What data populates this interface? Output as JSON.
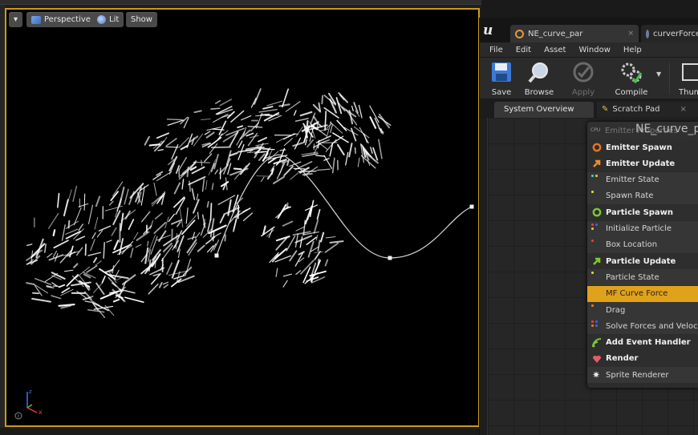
{
  "viewport": {
    "options_label": "▾",
    "perspective_label": "Perspective",
    "lit_label": "Lit",
    "show_label": "Show",
    "gizmo_icon": "axis-gizmo-icon"
  },
  "editor": {
    "tabs": [
      {
        "label": "NE_curve_par",
        "close": "×",
        "color": "#e09b40"
      },
      {
        "label": "curverForce",
        "color": "#9fb0c8"
      }
    ],
    "menu": [
      "File",
      "Edit",
      "Asset",
      "Window",
      "Help"
    ],
    "toolbar": {
      "save": "Save",
      "browse": "Browse",
      "apply": "Apply",
      "compile": "Compile",
      "thumbnail": "Thum"
    },
    "panel_tabs": {
      "system_overview": "System Overview",
      "scratch_pad": "Scratch Pad",
      "scratch_close": "×"
    },
    "stack": {
      "cpu_badge": "CPU",
      "header_faded": "Emitter Properties",
      "title": "NE_curve_p",
      "rows": [
        {
          "label": "Emitter Spawn",
          "kind": "group",
          "icon": "emitter-spawn-icon",
          "color": "#e8741e"
        },
        {
          "label": "Emitter Update",
          "kind": "group",
          "icon": "emitter-update-icon",
          "color": "#f08a28"
        },
        {
          "label": "Emitter State",
          "kind": "module",
          "dots": [
            "#40c8c8",
            "#e0c040"
          ]
        },
        {
          "label": "Spawn Rate",
          "kind": "module",
          "dots": [
            "#e0d040"
          ]
        },
        {
          "label": "Particle Spawn",
          "kind": "group",
          "icon": "particle-spawn-icon",
          "color": "#7cc832"
        },
        {
          "label": "Initialize Particle",
          "kind": "module",
          "dots": [
            "#e04040",
            "#4060e0",
            "#e0c040"
          ]
        },
        {
          "label": "Box Location",
          "kind": "module",
          "dots": [
            "#e04040"
          ]
        },
        {
          "label": "Particle Update",
          "kind": "group",
          "icon": "particle-update-icon",
          "color": "#7cc832"
        },
        {
          "label": "Particle State",
          "kind": "module",
          "dots": [
            "#e0d040"
          ]
        },
        {
          "label": "MF Curve Force",
          "kind": "selected",
          "dots": []
        },
        {
          "label": "Drag",
          "kind": "module",
          "dots": [
            "#e07a20"
          ]
        },
        {
          "label": "Solve Forces and Velocity",
          "kind": "module",
          "dots": [
            "#e04040",
            "#4060e0",
            "#e07a20",
            "#4060e0"
          ]
        },
        {
          "label": "Add Event Handler",
          "kind": "group",
          "icon": "event-handler-icon",
          "color": "#7cc832"
        },
        {
          "label": "Render",
          "kind": "group",
          "icon": "render-heart-icon",
          "color": "#e85a6a"
        },
        {
          "label": "Sprite Renderer",
          "kind": "module",
          "icon": "sprite-renderer-icon"
        }
      ]
    }
  }
}
